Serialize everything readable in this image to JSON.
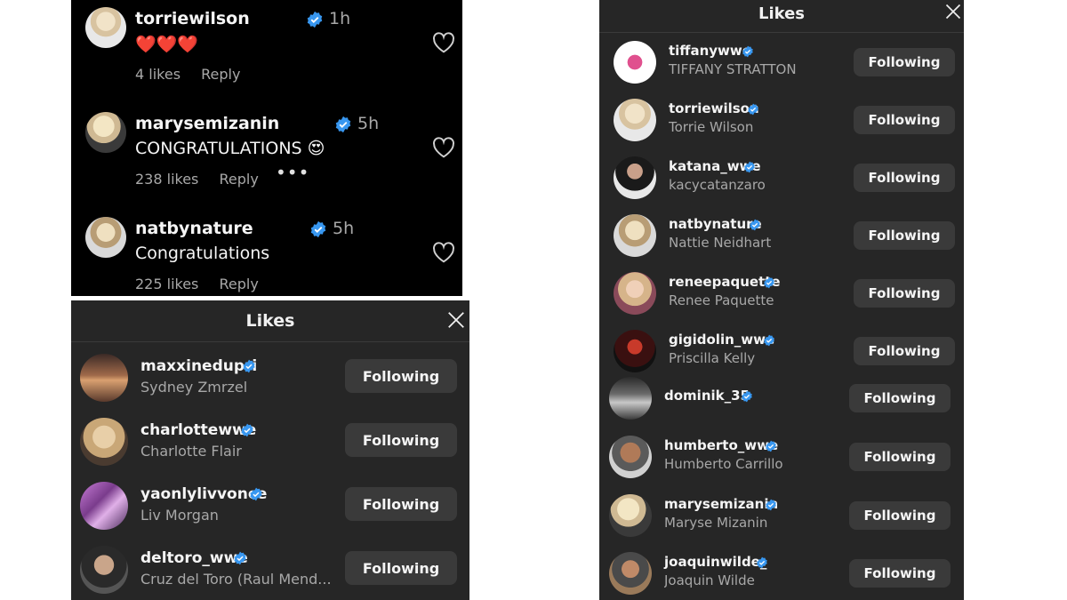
{
  "comments": [
    {
      "username": "torriewilson",
      "time": "1h",
      "text": "❤️❤️❤️",
      "likes": "4 likes",
      "reply": "Reply"
    },
    {
      "username": "marysemizanin",
      "time": "5h",
      "text": "CONGRATULATIONS 😍",
      "likes": "238 likes",
      "reply": "Reply",
      "more": "•••"
    },
    {
      "username": "natbynature",
      "time": "5h",
      "text": "Congratulations",
      "likes": "225 likes",
      "reply": "Reply"
    }
  ],
  "likes_left": {
    "title": "Likes",
    "users": [
      {
        "username": "maxxinedupri",
        "name": "Sydney Zmrzel",
        "button": "Following"
      },
      {
        "username": "charlottewwe",
        "name": "Charlotte Flair",
        "button": "Following"
      },
      {
        "username": "yaonlylivvonce",
        "name": "Liv Morgan",
        "button": "Following"
      },
      {
        "username": "deltoro_wwe",
        "name": "Cruz del Toro (Raul Mend...",
        "button": "Following"
      }
    ]
  },
  "likes_right": {
    "title": "Likes",
    "users": [
      {
        "username": "tiffanywwe",
        "name": "TIFFANY STRATTON",
        "button": "Following"
      },
      {
        "username": "torriewilson",
        "name": "Torrie Wilson",
        "button": "Following"
      },
      {
        "username": "katana_wwe",
        "name": "kacycatanzaro",
        "button": "Following"
      },
      {
        "username": "natbynature",
        "name": "Nattie Neidhart",
        "button": "Following"
      },
      {
        "username": "reneepaquette",
        "name": "Renee Paquette",
        "button": "Following"
      },
      {
        "username": "gigidolin_wwe",
        "name": "Priscilla Kelly",
        "button": "Following"
      },
      {
        "username": "dominik_35",
        "name": "",
        "button": "Following"
      },
      {
        "username": "humberto_wwe",
        "name": "Humberto Carrillo",
        "button": "Following"
      },
      {
        "username": "marysemizanin",
        "name": "Maryse Mizanin",
        "button": "Following"
      },
      {
        "username": "joaquinwilde_",
        "name": "Joaquin Wilde",
        "button": "Following"
      }
    ]
  },
  "colors": {
    "comments_bg": "#000000",
    "likes_bg": "#262626",
    "button_bg": "#3a3a3a",
    "verified": "#3897f0",
    "secondary_text": "#a8a8a8"
  },
  "icons": [
    "verified-badge-icon",
    "heart-outline-icon",
    "close-icon",
    "more-dots-icon"
  ]
}
